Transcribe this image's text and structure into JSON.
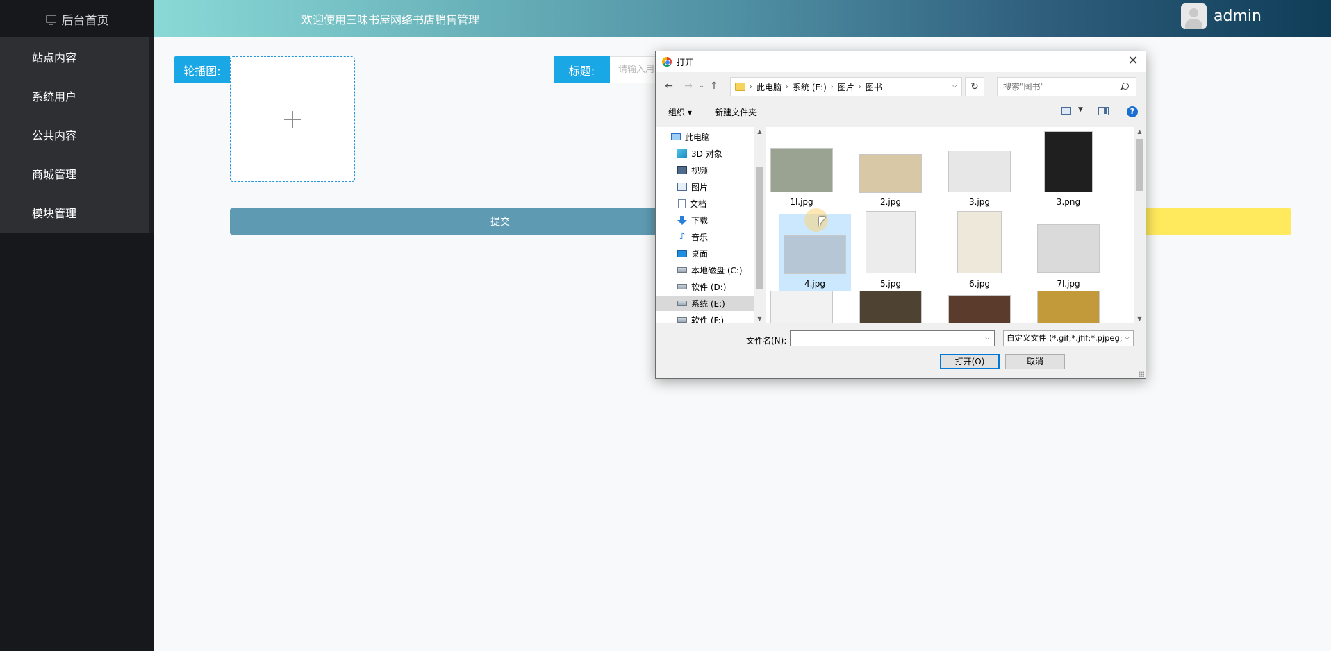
{
  "sidebar": {
    "home_label": "后台首页",
    "menu": [
      {
        "label": "站点内容"
      },
      {
        "label": "系统用户"
      },
      {
        "label": "公共内容"
      },
      {
        "label": "商城管理"
      },
      {
        "label": "模块管理"
      }
    ]
  },
  "header": {
    "title": "欢迎使用三味书屋网络书店销售管理",
    "username": "admin"
  },
  "form": {
    "carousel_label": "轮播图:",
    "title_label": "标题:",
    "title_placeholder": "请输入用",
    "submit_label": "提交"
  },
  "dialog": {
    "title": "打开",
    "breadcrumb": [
      "此电脑",
      "系统 (E:)",
      "图片",
      "图书"
    ],
    "search_placeholder": "搜索\"图书\"",
    "toolbar": {
      "organize": "组织 ▾",
      "new_folder": "新建文件夹"
    },
    "tree": [
      {
        "label": "此电脑",
        "icon": "pc"
      },
      {
        "label": "3D 对象",
        "icon": "3d"
      },
      {
        "label": "视频",
        "icon": "video"
      },
      {
        "label": "图片",
        "icon": "pic"
      },
      {
        "label": "文档",
        "icon": "doc"
      },
      {
        "label": "下载",
        "icon": "down"
      },
      {
        "label": "音乐",
        "icon": "music"
      },
      {
        "label": "桌面",
        "icon": "desk"
      },
      {
        "label": "本地磁盘 (C:)",
        "icon": "drive"
      },
      {
        "label": "软件 (D:)",
        "icon": "drive"
      },
      {
        "label": "系统 (E:)",
        "icon": "drive",
        "selected": true
      },
      {
        "label": "软件 (F:)",
        "icon": "drive"
      }
    ],
    "files": [
      {
        "name": "1l.jpg",
        "color": "#9aa392"
      },
      {
        "name": "2.jpg",
        "color": "#d9c8a5"
      },
      {
        "name": "3.jpg",
        "color": "#e7e7e7"
      },
      {
        "name": "3.png",
        "color": "#1f1f1f"
      },
      {
        "name": "4.jpg",
        "color": "#b7c6d4",
        "selected": true
      },
      {
        "name": "5.jpg",
        "color": "#ececec"
      },
      {
        "name": "6.jpg",
        "color": "#ede8d9"
      },
      {
        "name": "7l.jpg",
        "color": "#dadada"
      },
      {
        "name": "",
        "color": "#f2f2f2"
      },
      {
        "name": "",
        "color": "#4e4233"
      },
      {
        "name": "",
        "color": "#5a3b2c"
      },
      {
        "name": "",
        "color": "#c29a3a"
      }
    ],
    "filename_label": "文件名(N):",
    "filename_value": "",
    "filetype_value": "自定义文件 (*.gif;*.jfif;*.pjpeg;",
    "open_button": "打开(O)",
    "cancel_button": "取消"
  }
}
